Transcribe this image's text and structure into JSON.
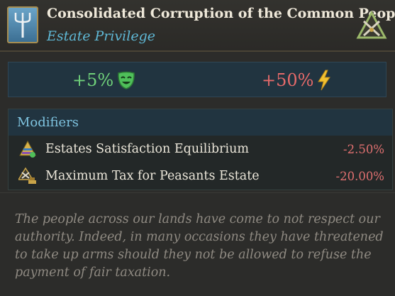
{
  "header": {
    "title": "Consolidated Corruption of the Common People",
    "subtitle": "Estate Privilege",
    "left_icon": "pitchfork-icon",
    "right_icon": "tools-triangle-icon"
  },
  "stats": {
    "left_value": "+5%",
    "left_icon": "happy-mask-icon",
    "right_value": "+50%",
    "right_icon": "lightning-icon"
  },
  "modifiers": {
    "heading": "Modifiers",
    "rows": [
      {
        "label": "Estates Satisfaction Equilibrium",
        "value": "-2.50%",
        "icon": "estate-pyramid-icon"
      },
      {
        "label": "Maximum Tax for Peasants Estate",
        "value": "-20.00%",
        "icon": "peasant-tax-icon"
      }
    ]
  },
  "description": "The people across our lands have come to not respect our authority. Indeed, in many occasions they have threatened to take up arms should they not be allowed to refuse the payment of fair taxation.",
  "colors": {
    "positive": "#6fd07a",
    "negative": "#e66a6a",
    "accent": "#5fb8d6"
  }
}
